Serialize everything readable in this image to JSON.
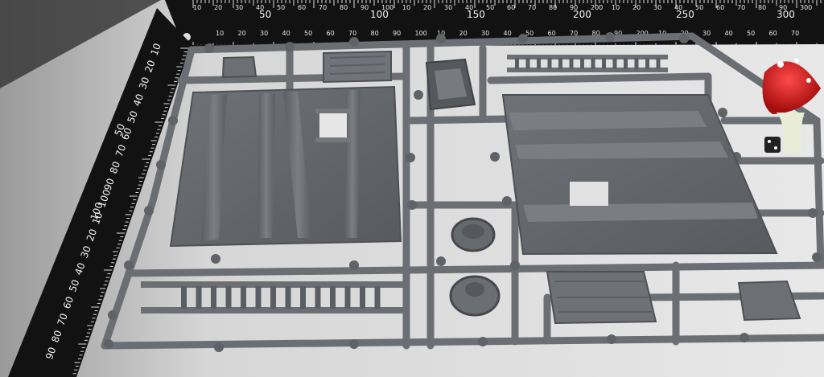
{
  "photo": {
    "top_ruler_major": [
      "50",
      "100",
      "150",
      "200",
      "250",
      "300"
    ],
    "top_ruler_minor_top": [
      "10",
      "20",
      "30",
      "40",
      "50",
      "60",
      "70",
      "80",
      "90",
      "100",
      "10",
      "20",
      "30",
      "40",
      "50",
      "60",
      "70",
      "80",
      "90",
      "200",
      "10",
      "20",
      "30",
      "40",
      "50",
      "60",
      "70",
      "80",
      "90",
      "300"
    ],
    "top_ruler_minor_bottom": [
      "10",
      "20",
      "30",
      "40",
      "50",
      "60",
      "70",
      "80",
      "90",
      "100",
      "10",
      "20",
      "30",
      "40",
      "50",
      "60",
      "70",
      "80",
      "90",
      "200",
      "10",
      "20",
      "30",
      "40",
      "50",
      "60",
      "70"
    ],
    "side_ruler_major": [
      "50",
      "100"
    ],
    "side_ruler_numbers": [
      "10",
      "20",
      "30",
      "40",
      "50",
      "60",
      "70",
      "80",
      "90",
      "100",
      "10",
      "20",
      "30",
      "40",
      "50",
      "60",
      "70",
      "80",
      "90"
    ],
    "colors": {
      "background": "#d9d9d9",
      "ruler": "#121212",
      "sprue": "#6b6e73",
      "sprue_dark": "#4d5055",
      "mushroom_red": "#d81f1f"
    }
  }
}
